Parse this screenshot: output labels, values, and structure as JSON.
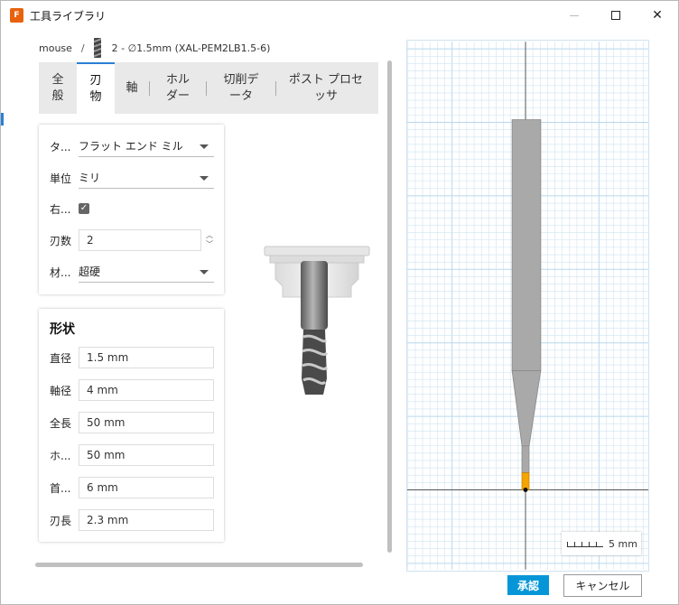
{
  "window": {
    "title": "工具ライブラリ",
    "app_icon_letter": "F"
  },
  "breadcrumb": {
    "library": "mouse",
    "separator": "/",
    "tool": "2 - ∅1.5mm (XAL-PEM2LB1.5-6)"
  },
  "tabs": [
    {
      "label": "全\n般",
      "active": false
    },
    {
      "label": "刃\n物",
      "active": true
    },
    {
      "label": "軸",
      "active": false
    },
    {
      "label": "ホル\nダー",
      "active": false
    },
    {
      "label": "切削デ\nータ",
      "active": false
    },
    {
      "label": "ポスト プロセ\nッサ",
      "active": false
    }
  ],
  "cutter": {
    "type_label": "タ...",
    "type_value": "フラット エンド ミル",
    "unit_label": "単位",
    "unit_value": "ミリ",
    "right_hand_label": "右...",
    "right_hand_checked": true,
    "flutes_label": "刃数",
    "flutes_value": "2",
    "material_label": "材...",
    "material_value": "超硬"
  },
  "shape": {
    "title": "形状",
    "diameter_label": "直径",
    "diameter_value": "1.5 mm",
    "shaft_label": "軸径",
    "shaft_value": "4 mm",
    "overall_label": "全長",
    "overall_value": "50 mm",
    "holder_label": "ホ...",
    "holder_value": "50 mm",
    "neck_label": "首...",
    "neck_value": "6 mm",
    "flute_label": "刃長",
    "flute_value": "2.3 mm"
  },
  "preview": {
    "scale_text": "5 mm",
    "grid_color": "#cfe3f1",
    "tool_color": "#a9a9a9",
    "flute_color": "#f5a400"
  },
  "buttons": {
    "ok": "承認",
    "cancel": "キャンセル"
  },
  "colors": {
    "accent": "#0696d7",
    "tab_accent": "#2a7fd4"
  }
}
